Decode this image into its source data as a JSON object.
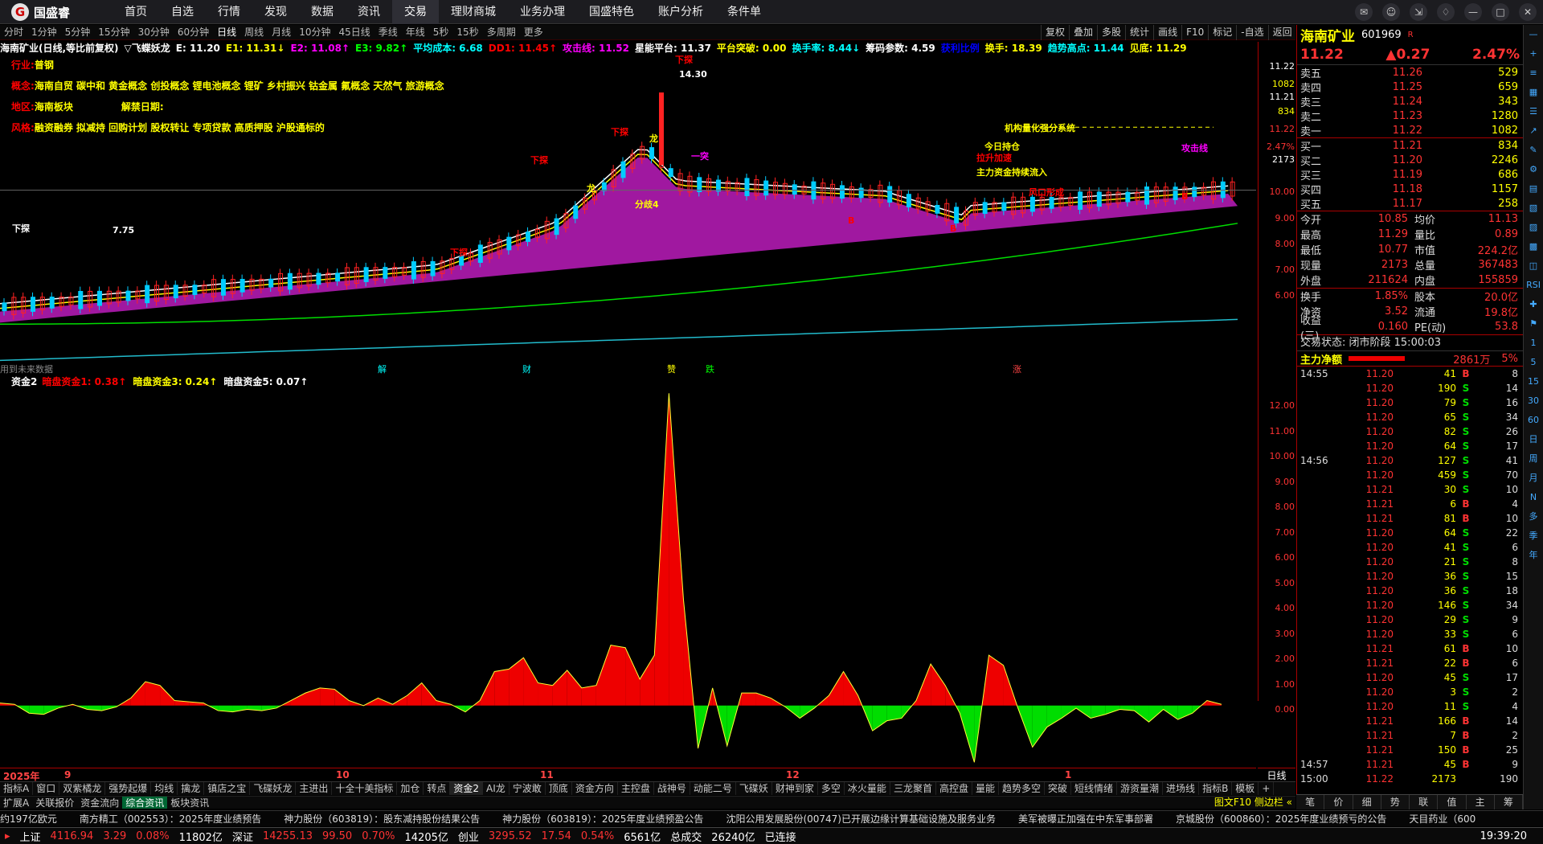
{
  "app": {
    "logo": "国盛睿",
    "nav": [
      "首页",
      "自选",
      "行情",
      "发现",
      "数据",
      "资讯",
      "交易",
      "理财商城",
      "业务办理",
      "国盛特色",
      "账户分析",
      "条件单"
    ],
    "active": "交易",
    "window_icons": [
      "chat-icon",
      "user-icon",
      "expand-icon",
      "shirt-icon",
      "minimize-icon",
      "maximize-icon",
      "close-icon"
    ]
  },
  "periods": [
    "分时",
    "1分钟",
    "5分钟",
    "15分钟",
    "30分钟",
    "60分钟",
    "日线",
    "周线",
    "月线",
    "10分钟",
    "45日线",
    "季线",
    "年线",
    "5秒",
    "15秒",
    "多周期",
    "更多"
  ],
  "active_period": "日线",
  "right_tools": [
    "复权",
    "叠加",
    "多股",
    "统计",
    "画线",
    "F10",
    "标记",
    "-自选",
    "返回"
  ],
  "chart_info": [
    {
      "t": "海南矿业(日线,等比前复权)",
      "c": "#fff"
    },
    {
      "t": "▽飞蝶妖龙",
      "c": "#fff"
    },
    {
      "t": "E: 11.20",
      "c": "#fff"
    },
    {
      "t": "E1: 11.31↓",
      "c": "#ff0"
    },
    {
      "t": "E2: 11.08↑",
      "c": "#f0f"
    },
    {
      "t": "E3: 9.82↑",
      "c": "#0f0"
    },
    {
      "t": "平均成本: 6.68",
      "c": "#0ff"
    },
    {
      "t": "DD1: 11.45↑",
      "c": "#f00"
    },
    {
      "t": "攻击线: 11.52",
      "c": "#f0f"
    },
    {
      "t": "星能平台: 11.37",
      "c": "#fff"
    },
    {
      "t": "平台突破: 0.00",
      "c": "#ff0"
    },
    {
      "t": "换手率: 8.44↓",
      "c": "#0ff"
    },
    {
      "t": "筹码参数: 4.59",
      "c": "#fff"
    },
    {
      "t": "获利比例",
      "c": "#00f"
    },
    {
      "t": "换手: 18.39",
      "c": "#ff0"
    },
    {
      "t": "趋势高点: 11.44",
      "c": "#0ff"
    },
    {
      "t": "见底: 11.29",
      "c": "#ff0"
    }
  ],
  "stock_info": [
    {
      "k": "行业:",
      "v": "普钢"
    },
    {
      "k": "概念:",
      "v": "海南自贸 碳中和 黄金概念 创投概念 锂电池概念 锂矿 乡村振兴 钴金属 氟概念 天然气 旅游概念"
    },
    {
      "k": "地区:",
      "v": "海南板块",
      "k2": "解禁日期:",
      "v2": ""
    },
    {
      "k": "风格:",
      "v": "融资融券 拟减持 回购计划 股权转让 专项贷款 高质押股 沪股通标的"
    }
  ],
  "chart_annotations": [
    "下探",
    "下探",
    "下探",
    "下探",
    "下探",
    "分歧4",
    "龙",
    "龙",
    "一突",
    "7.75",
    "机构量化强分系统",
    "主力资金持续流入",
    "攻击线",
    "风口形成",
    "B",
    "B",
    "B",
    "14.30",
    "今日持仓",
    "拉升加速"
  ],
  "price_axis": [
    "11.22",
    "1082",
    "11.21",
    "834",
    "11.22",
    "2.47%",
    "2173",
    "10.00",
    "9.00",
    "8.00",
    "7.00",
    "6.00"
  ],
  "bottom_labels": [
    {
      "t": "用到未来数据",
      "c": "#888"
    },
    {
      "t": "解",
      "c": "#0ff"
    },
    {
      "t": "财",
      "c": "#0ff"
    },
    {
      "t": "赞",
      "c": "#ff0"
    },
    {
      "t": "跌",
      "c": "#0f0"
    },
    {
      "t": "涨",
      "c": "#f44"
    }
  ],
  "indicator": {
    "name": "资金2",
    "lines": [
      {
        "t": "暗盘资金1: 0.38↑",
        "c": "#f00"
      },
      {
        "t": "暗盘资金3: 0.24↑",
        "c": "#ff0"
      },
      {
        "t": "暗盘资金5: 0.07↑",
        "c": "#fff"
      }
    ],
    "axis": [
      "12.00",
      "11.00",
      "10.00",
      "9.00",
      "8.00",
      "7.00",
      "6.00",
      "5.00",
      "4.00",
      "3.00",
      "2.00",
      "1.00",
      "0.00"
    ]
  },
  "xaxis": [
    "2025年",
    "9",
    "10",
    "11",
    "12",
    "1"
  ],
  "chart_data": {
    "type": "area",
    "name": "资金2 暗盘资金",
    "x_labels": [
      "2025年",
      "9",
      "10",
      "11",
      "12",
      "1"
    ],
    "ylim": [
      -2.4,
      12.6
    ],
    "values": [
      0.1,
      0.05,
      -0.3,
      -0.35,
      -0.1,
      0.05,
      -0.15,
      -0.2,
      -0.05,
      0.3,
      0.95,
      0.8,
      0.2,
      0.15,
      0.1,
      -0.2,
      -0.25,
      -0.15,
      -0.2,
      -0.1,
      0.2,
      0.5,
      0.7,
      0.65,
      0.2,
      0,
      0.3,
      0.05,
      0.4,
      0.9,
      0.2,
      0.05,
      -0.25,
      0.2,
      1.35,
      1.45,
      1.9,
      0.9,
      0.8,
      1.4,
      0.7,
      0.8,
      2.4,
      2.3,
      1.05,
      2.0,
      12.4,
      4.2,
      -1.7,
      0.7,
      -1.6,
      0.5,
      0.5,
      0.3,
      -0.05,
      -0.5,
      -0.1,
      0.4,
      1.35,
      0.4,
      -1.0,
      -0.6,
      -0.5,
      0.2,
      1.65,
      0.8,
      -0.3,
      -2.25,
      2.0,
      1.6,
      -0.1,
      -1.65,
      -0.85,
      -0.5,
      -0.1,
      -0.5,
      -0.35,
      -0.15,
      -0.2,
      -0.65,
      -0.15,
      -0.55,
      -0.3,
      0.2,
      0.05
    ]
  },
  "tabs1": [
    "指标A",
    "窗口",
    "双紫橘龙",
    "强势起爆",
    "均线",
    "擒龙",
    "镇店之宝",
    "飞碟妖龙",
    "主进出",
    "十全十美指标",
    "加仓",
    "转点",
    "资金2",
    "AI龙",
    "宁波敢",
    "顶底",
    "资金方向",
    "主控盘",
    "战神号",
    "动能二号",
    "飞碟妖",
    "财神到家",
    "多空",
    "冰火量能",
    "三龙聚首",
    "高控盘",
    "量能",
    "趋势多空",
    "突破",
    "短线情绪",
    "游资量潮",
    "进场线",
    "指标B",
    "模板",
    "+"
  ],
  "tabs1_active": "资金2",
  "tabs2": [
    "扩展A",
    "关联报价",
    "资金流向",
    "综合资讯",
    "板块资讯"
  ],
  "tabs2_active": "综合资讯",
  "tabs2_right": "图文F10 侧边栏 «",
  "news": [
    "约197亿欧元",
    "南方精工（002553）：2025年度业绩预告",
    "神力股份（603819）：股东减持股份结果公告",
    "神力股份（603819）：2025年度业绩预盈公告",
    "沈阳公用发展股份(00747)已开展边缘计算基础设施及服务业务",
    "美军被曝正加强在中东军事部署",
    "京城股份（600860）：2025年度业绩预亏的公告",
    "天目药业（600"
  ],
  "status": [
    {
      "t": "上证",
      "c": "#fff"
    },
    {
      "t": "4116.94",
      "c": "#f33"
    },
    {
      "t": "3.29",
      "c": "#f33"
    },
    {
      "t": "0.08%",
      "c": "#f33"
    },
    {
      "t": "11802亿",
      "c": "#fff"
    },
    {
      "t": "深证",
      "c": "#fff"
    },
    {
      "t": "14255.13",
      "c": "#f33"
    },
    {
      "t": "99.50",
      "c": "#f33"
    },
    {
      "t": "0.70%",
      "c": "#f33"
    },
    {
      "t": "14205亿",
      "c": "#fff"
    },
    {
      "t": "创业",
      "c": "#fff"
    },
    {
      "t": "3295.52",
      "c": "#f33"
    },
    {
      "t": "17.54",
      "c": "#f33"
    },
    {
      "t": "0.54%",
      "c": "#f33"
    },
    {
      "t": "6561亿",
      "c": "#fff"
    },
    {
      "t": "总成交",
      "c": "#fff"
    },
    {
      "t": "26240亿",
      "c": "#fff"
    },
    {
      "t": "已连接",
      "c": "#fff"
    }
  ],
  "clock": "19:39:20",
  "quote": {
    "name": "海南矿业",
    "code": "601969",
    "badge": "R",
    "price": "11.22",
    "change": "▲0.27",
    "pct": "2.47%",
    "asks": [
      {
        "l": "卖五",
        "p": "11.26",
        "v": "529"
      },
      {
        "l": "卖四",
        "p": "11.25",
        "v": "659"
      },
      {
        "l": "卖三",
        "p": "11.24",
        "v": "343"
      },
      {
        "l": "卖二",
        "p": "11.23",
        "v": "1280"
      },
      {
        "l": "卖一",
        "p": "11.22",
        "v": "1082"
      }
    ],
    "bids": [
      {
        "l": "买一",
        "p": "11.21",
        "v": "834"
      },
      {
        "l": "买二",
        "p": "11.20",
        "v": "2246"
      },
      {
        "l": "买三",
        "p": "11.19",
        "v": "686"
      },
      {
        "l": "买四",
        "p": "11.18",
        "v": "1157"
      },
      {
        "l": "买五",
        "p": "11.17",
        "v": "258"
      }
    ],
    "stats": [
      {
        "k1": "今开",
        "v1": "10.85",
        "k2": "均价",
        "v2": "11.13"
      },
      {
        "k1": "最高",
        "v1": "11.29",
        "k2": "量比",
        "v2": "0.89"
      },
      {
        "k1": "最低",
        "v1": "10.77",
        "k2": "市值",
        "v2": "224.2亿"
      },
      {
        "k1": "现量",
        "v1": "2173",
        "k2": "总量",
        "v2": "367483"
      },
      {
        "k1": "外盘",
        "v1": "211624",
        "k2": "内盘",
        "v2": "155859"
      }
    ],
    "stats2": [
      {
        "k1": "换手",
        "v1": "1.85%",
        "k2": "股本",
        "v2": "20.0亿"
      },
      {
        "k1": "净资",
        "v1": "3.52",
        "k2": "流通",
        "v2": "19.8亿"
      },
      {
        "k1": "收益(三)",
        "v1": "0.160",
        "k2": "PE(动)",
        "v2": "53.8"
      }
    ],
    "trade_state": "交易状态: 闭市阶段 15:00:03",
    "main_flow_label": "主力净额",
    "main_flow": "2861万",
    "main_flow_pct": "5%",
    "ticks": [
      {
        "t": "14:55",
        "p": "11.20",
        "v": "41",
        "d": "B",
        "n": "8"
      },
      {
        "t": "",
        "p": "11.20",
        "v": "190",
        "d": "S",
        "n": "14"
      },
      {
        "t": "",
        "p": "11.20",
        "v": "79",
        "d": "S",
        "n": "16"
      },
      {
        "t": "",
        "p": "11.20",
        "v": "65",
        "d": "S",
        "n": "34"
      },
      {
        "t": "",
        "p": "11.20",
        "v": "82",
        "d": "S",
        "n": "26"
      },
      {
        "t": "",
        "p": "11.20",
        "v": "64",
        "d": "S",
        "n": "17"
      },
      {
        "t": "14:56",
        "p": "11.20",
        "v": "127",
        "d": "S",
        "n": "41"
      },
      {
        "t": "",
        "p": "11.20",
        "v": "459",
        "d": "S",
        "n": "70"
      },
      {
        "t": "",
        "p": "11.21",
        "v": "30",
        "d": "S",
        "n": "10"
      },
      {
        "t": "",
        "p": "11.21",
        "v": "6",
        "d": "B",
        "n": "4"
      },
      {
        "t": "",
        "p": "11.21",
        "v": "81",
        "d": "B",
        "n": "10"
      },
      {
        "t": "",
        "p": "11.20",
        "v": "64",
        "d": "S",
        "n": "22"
      },
      {
        "t": "",
        "p": "11.20",
        "v": "41",
        "d": "S",
        "n": "6"
      },
      {
        "t": "",
        "p": "11.20",
        "v": "21",
        "d": "S",
        "n": "8"
      },
      {
        "t": "",
        "p": "11.20",
        "v": "36",
        "d": "S",
        "n": "15"
      },
      {
        "t": "",
        "p": "11.20",
        "v": "36",
        "d": "S",
        "n": "18"
      },
      {
        "t": "",
        "p": "11.20",
        "v": "146",
        "d": "S",
        "n": "34"
      },
      {
        "t": "",
        "p": "11.20",
        "v": "29",
        "d": "S",
        "n": "9"
      },
      {
        "t": "",
        "p": "11.20",
        "v": "33",
        "d": "S",
        "n": "6"
      },
      {
        "t": "",
        "p": "11.21",
        "v": "61",
        "d": "B",
        "n": "10"
      },
      {
        "t": "",
        "p": "11.21",
        "v": "22",
        "d": "B",
        "n": "6"
      },
      {
        "t": "",
        "p": "11.20",
        "v": "45",
        "d": "S",
        "n": "17"
      },
      {
        "t": "",
        "p": "11.20",
        "v": "3",
        "d": "S",
        "n": "2"
      },
      {
        "t": "",
        "p": "11.20",
        "v": "11",
        "d": "S",
        "n": "4"
      },
      {
        "t": "",
        "p": "11.21",
        "v": "166",
        "d": "B",
        "n": "14"
      },
      {
        "t": "",
        "p": "11.21",
        "v": "7",
        "d": "B",
        "n": "2"
      },
      {
        "t": "",
        "p": "11.21",
        "v": "150",
        "d": "B",
        "n": "25"
      },
      {
        "t": "14:57",
        "p": "11.21",
        "v": "45",
        "d": "B",
        "n": "9"
      },
      {
        "t": "15:00",
        "p": "11.22",
        "v": "2173",
        "d": "",
        "n": "190"
      }
    ],
    "tabs": [
      "笔",
      "价",
      "细",
      "势",
      "联",
      "值",
      "主",
      "筹"
    ]
  },
  "side_icons": [
    "—",
    "+",
    "≡",
    "▦",
    "☰",
    "↗",
    "✎",
    "⚙",
    "▤",
    "▧",
    "▨",
    "▩",
    "◫",
    "RSI",
    "✚",
    "⚑",
    "1",
    "5",
    "15",
    "30",
    "60",
    "日",
    "周",
    "月",
    "N",
    "多",
    "季",
    "年"
  ]
}
